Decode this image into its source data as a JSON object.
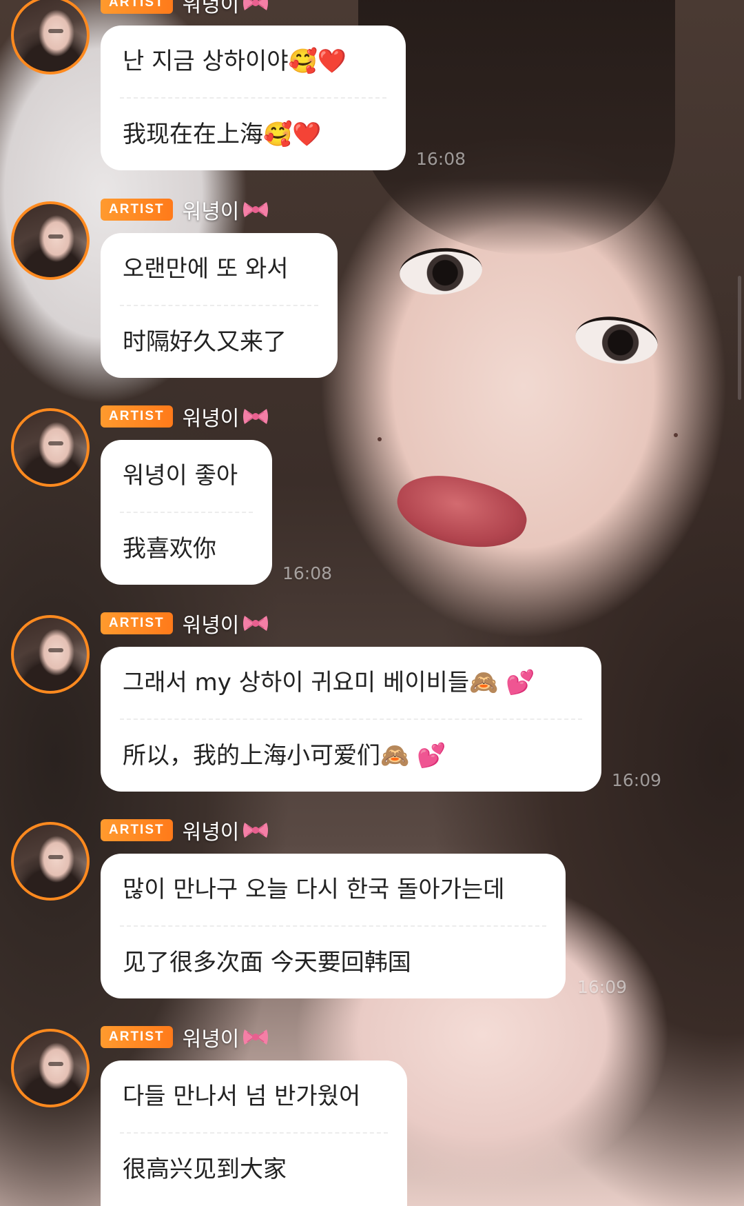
{
  "messages": [
    {
      "badge": "ARTIST",
      "name": "워녕이",
      "korean": "난 지금 상하이야🥰❤️",
      "chinese": "我现在在上海🥰❤️",
      "time": "16:08"
    },
    {
      "badge": "ARTIST",
      "name": "워녕이",
      "korean": "오랜만에 또 와서",
      "chinese": "时隔好久又来了",
      "time": ""
    },
    {
      "badge": "ARTIST",
      "name": "워녕이",
      "korean": "워녕이 좋아",
      "chinese": "我喜欢你",
      "time": "16:08"
    },
    {
      "badge": "ARTIST",
      "name": "워녕이",
      "korean": "그래서 my 상하이 귀요미 베이비들🙈 💕",
      "chinese": "所以，我的上海小可爱们🙈 💕",
      "time": "16:09"
    },
    {
      "badge": "ARTIST",
      "name": "워녕이",
      "korean": "많이 만나구 오늘 다시 한국 돌아가는데",
      "chinese": "见了很多次面 今天要回韩国",
      "time": "16:09"
    },
    {
      "badge": "ARTIST",
      "name": "워녕이",
      "korean": "다들 만나서 넘 반가웠어",
      "chinese": "很高兴见到大家",
      "time": ""
    }
  ],
  "colors": {
    "avatar_ring": "#ff8a1f",
    "badge": "#ff7a1a",
    "bubble": "#ffffff"
  },
  "icons": {
    "name_suffix": "ribbon-bow-icon"
  }
}
